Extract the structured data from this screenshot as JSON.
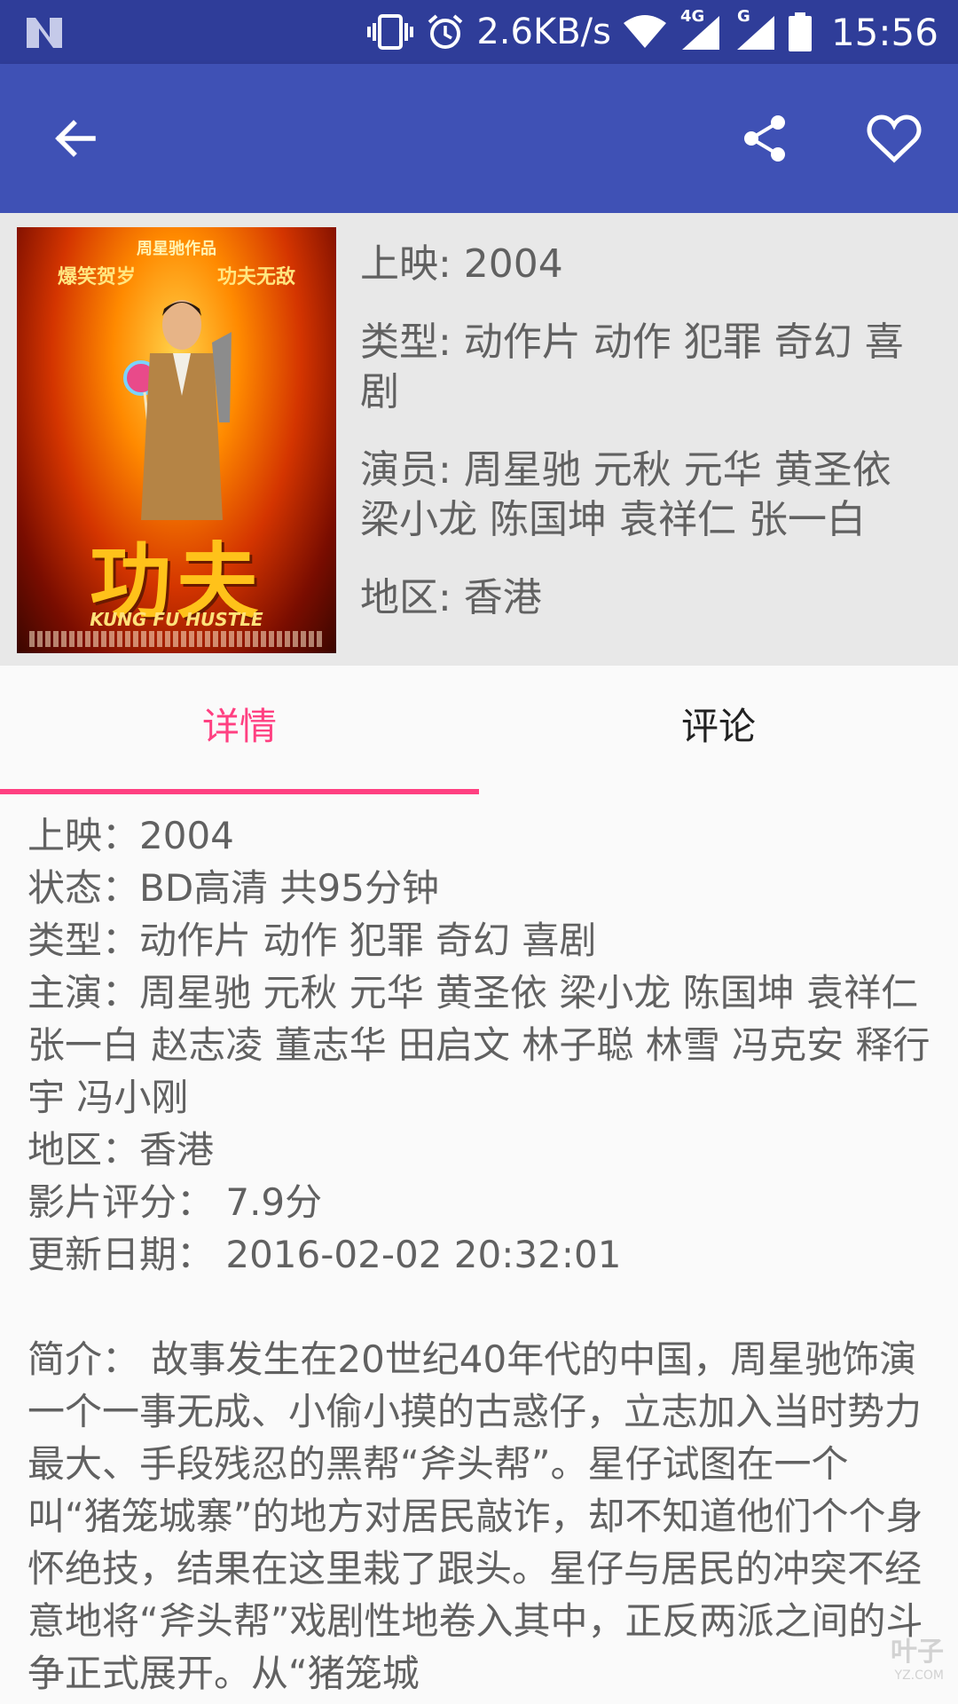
{
  "status_bar": {
    "net_speed": "2.6KB/s",
    "network_1": "4G",
    "network_2": "G",
    "time": "15:56",
    "icons": [
      "n-logo-icon",
      "vibrate-icon",
      "alarm-icon",
      "wifi-icon",
      "signal-icon",
      "signal-icon",
      "battery-icon"
    ]
  },
  "app_bar": {
    "icons": [
      "back-arrow-icon",
      "share-icon",
      "heart-icon"
    ],
    "color": "#3f51b5"
  },
  "movie": {
    "poster": {
      "credit": "周星驰作品",
      "slogan_left": "爆笑贺岁",
      "slogan_right": "功夫无敌",
      "title": "功夫",
      "subtitle": "KUNG FU HUSTLE"
    },
    "release": "上映: 2004",
    "genre": "类型: 动作片 动作 犯罪 奇幻 喜剧",
    "cast": "演员: 周星驰 元秋 元华 黄圣依 梁小龙 陈国坤 袁祥仁 张一白",
    "region": "地区: 香港"
  },
  "tabs": {
    "details": "详情",
    "comments": "评论",
    "active_color": "#ff4081"
  },
  "details": {
    "release": "上映：2004",
    "status": "状态：BD高清 共95分钟",
    "genre": "类型：动作片 动作 犯罪 奇幻 喜剧",
    "cast": "主演：周星驰 元秋 元华 黄圣依 梁小龙 陈国坤 袁祥仁 张一白 赵志凌 董志华 田启文 林子聪 林雪 冯克安 释行宇 冯小刚",
    "region": "地区：香港",
    "rating": "影片评分： 7.9分",
    "updated": "更新日期： 2016-02-02 20:32:01",
    "synopsis": "简介： 故事发生在20世纪40年代的中国，周星驰饰演一个一事无成、小偷小摸的古惑仔，立志加入当时势力最大、手段残忍的黑帮“斧头帮”。星仔试图在一个叫“猪笼城寨”的地方对居民敲诈，却不知道他们个个身怀绝技，结果在这里栽了跟头。星仔与居民的冲突不经意地将“斧头帮”戏剧性地卷入其中，正反两派之间的斗争正式展开。从“猪笼城"
  },
  "watermark": {
    "text": "叶子",
    "sub": "YZ.COM"
  }
}
